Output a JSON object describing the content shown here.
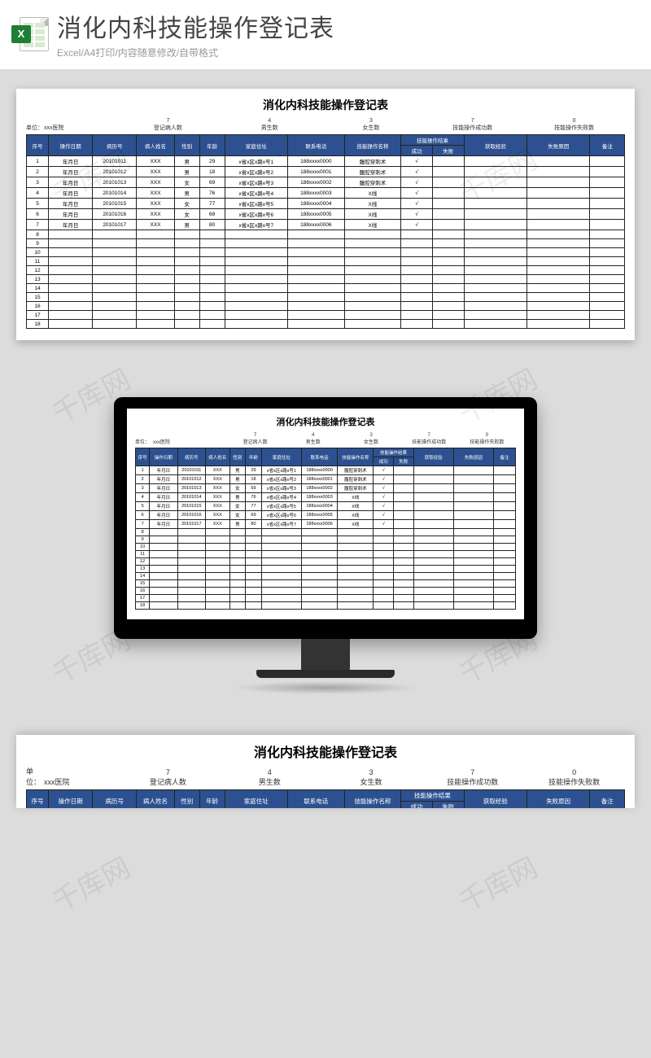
{
  "header": {
    "big_title": "消化内科技能操作登记表",
    "subtitle": "Excel/A4打印/内容随意修改/自带格式",
    "icon_letter": "X"
  },
  "sheet": {
    "title": "消化内科技能操作登记表",
    "unit_label": "单位：",
    "hospital": "xxx医院",
    "stats": [
      {
        "num": "7",
        "label": "登记病人数"
      },
      {
        "num": "4",
        "label": "男生数"
      },
      {
        "num": "3",
        "label": "女生数"
      },
      {
        "num": "7",
        "label": "技能操作成功数"
      },
      {
        "num": "0",
        "label": "技能操作失败数"
      }
    ],
    "columns": {
      "seq": "序号",
      "date": "操作日期",
      "caseno": "病历号",
      "name": "病人姓名",
      "sex": "性别",
      "age": "年龄",
      "addr": "家庭住址",
      "phone": "联系电话",
      "op": "技能操作名称",
      "result_group": "技能操作结果",
      "success": "成功",
      "fail": "失败",
      "exp": "获取经验",
      "reason": "失败原因",
      "note": "备注"
    },
    "rows": [
      {
        "seq": "1",
        "date": "年月日",
        "caseno": "20101011",
        "name": "XXX",
        "sex": "男",
        "age": "29",
        "addr": "x省x区x路x号1",
        "phone": "188xxxx0000",
        "op": "腹腔穿刺术",
        "succ": "√",
        "fail": ""
      },
      {
        "seq": "2",
        "date": "年月日",
        "caseno": "20101012",
        "name": "XXX",
        "sex": "男",
        "age": "18",
        "addr": "x省x区x路x号2",
        "phone": "188xxxx0001",
        "op": "腹腔穿刺术",
        "succ": "√",
        "fail": ""
      },
      {
        "seq": "3",
        "date": "年月日",
        "caseno": "20101013",
        "name": "XXX",
        "sex": "女",
        "age": "69",
        "addr": "x省x区x路x号3",
        "phone": "188xxxx0002",
        "op": "腹腔穿刺术",
        "succ": "√",
        "fail": ""
      },
      {
        "seq": "4",
        "date": "年月日",
        "caseno": "20101014",
        "name": "XXX",
        "sex": "男",
        "age": "76",
        "addr": "x省x区x路x号4",
        "phone": "188xxxx0003",
        "op": "X线",
        "succ": "√",
        "fail": ""
      },
      {
        "seq": "5",
        "date": "年月日",
        "caseno": "20101015",
        "name": "XXX",
        "sex": "女",
        "age": "77",
        "addr": "x省x区x路x号5",
        "phone": "188xxxx0004",
        "op": "X线",
        "succ": "√",
        "fail": ""
      },
      {
        "seq": "6",
        "date": "年月日",
        "caseno": "20101016",
        "name": "XXX",
        "sex": "女",
        "age": "69",
        "addr": "x省x区x路x号6",
        "phone": "188xxxx0005",
        "op": "X线",
        "succ": "√",
        "fail": ""
      },
      {
        "seq": "7",
        "date": "年月日",
        "caseno": "20101017",
        "name": "XXX",
        "sex": "男",
        "age": "80",
        "addr": "x省x区x路x号7",
        "phone": "188xxxx0006",
        "op": "X线",
        "succ": "√",
        "fail": ""
      }
    ],
    "total_rows": 18
  },
  "watermark": "千库网",
  "chart_data": {
    "type": "table",
    "title": "消化内科技能操作登记表",
    "columns": [
      "序号",
      "操作日期",
      "病历号",
      "病人姓名",
      "性别",
      "年龄",
      "家庭住址",
      "联系电话",
      "技能操作名称",
      "成功",
      "失败",
      "获取经验",
      "失败原因",
      "备注"
    ],
    "rows": [
      [
        "1",
        "年月日",
        "20101011",
        "XXX",
        "男",
        "29",
        "x省x区x路x号1",
        "188xxxx0000",
        "腹腔穿刺术",
        "√",
        "",
        "",
        "",
        ""
      ],
      [
        "2",
        "年月日",
        "20101012",
        "XXX",
        "男",
        "18",
        "x省x区x路x号2",
        "188xxxx0001",
        "腹腔穿刺术",
        "√",
        "",
        "",
        "",
        ""
      ],
      [
        "3",
        "年月日",
        "20101013",
        "XXX",
        "女",
        "69",
        "x省x区x路x号3",
        "188xxxx0002",
        "腹腔穿刺术",
        "√",
        "",
        "",
        "",
        ""
      ],
      [
        "4",
        "年月日",
        "20101014",
        "XXX",
        "男",
        "76",
        "x省x区x路x号4",
        "188xxxx0003",
        "X线",
        "√",
        "",
        "",
        "",
        ""
      ],
      [
        "5",
        "年月日",
        "20101015",
        "XXX",
        "女",
        "77",
        "x省x区x路x号5",
        "188xxxx0004",
        "X线",
        "√",
        "",
        "",
        "",
        ""
      ],
      [
        "6",
        "年月日",
        "20101016",
        "XXX",
        "女",
        "69",
        "x省x区x路x号6",
        "188xxxx0005",
        "X线",
        "√",
        "",
        "",
        "",
        ""
      ],
      [
        "7",
        "年月日",
        "20101017",
        "XXX",
        "男",
        "80",
        "x省x区x路x号7",
        "188xxxx0006",
        "X线",
        "√",
        "",
        "",
        "",
        ""
      ]
    ],
    "summary": {
      "登记病人数": 7,
      "男生数": 4,
      "女生数": 3,
      "技能操作成功数": 7,
      "技能操作失败数": 0
    }
  }
}
